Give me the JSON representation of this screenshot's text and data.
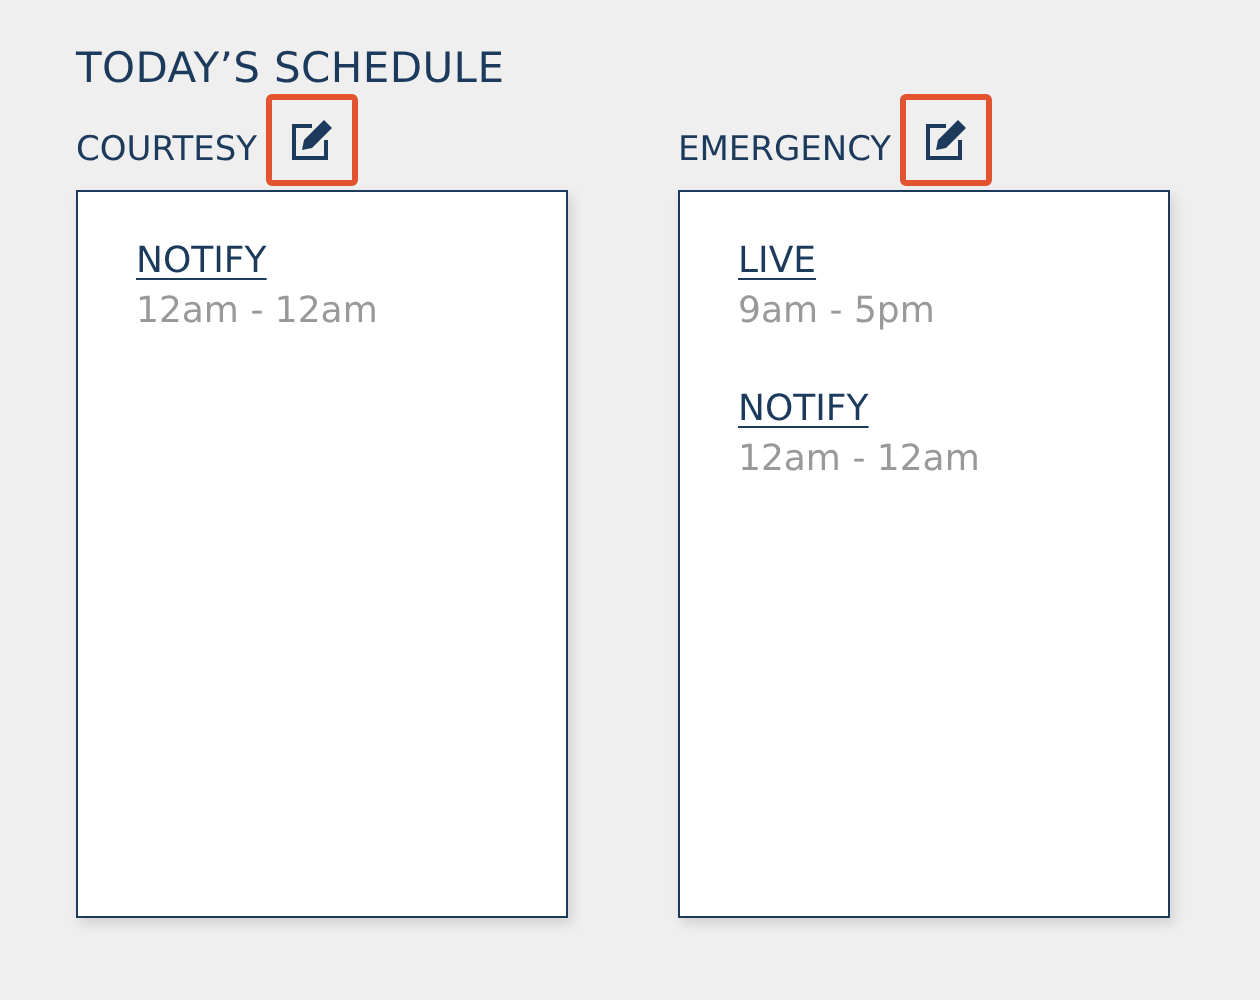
{
  "title": "TODAY’S SCHEDULE",
  "columns": [
    {
      "label": "COURTESY",
      "edit_highlighted": true,
      "entries": [
        {
          "link": "NOTIFY",
          "time": "12am - 12am"
        }
      ]
    },
    {
      "label": "EMERGENCY",
      "edit_highlighted": true,
      "entries": [
        {
          "link": "LIVE",
          "time": "9am - 5pm"
        },
        {
          "link": "NOTIFY",
          "time": "12am - 12am"
        }
      ]
    }
  ]
}
